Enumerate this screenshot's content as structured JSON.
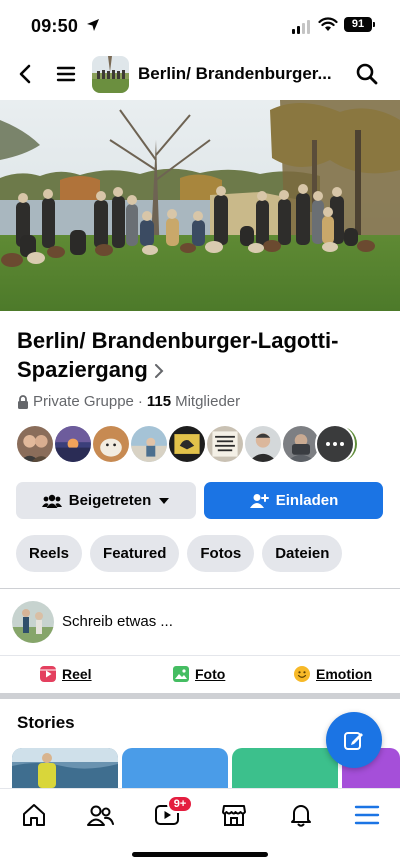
{
  "status_bar": {
    "time": "09:50",
    "battery": "91"
  },
  "header": {
    "title": "Berlin/ Brandenburger..."
  },
  "group": {
    "name": "Berlin/ Brandenburger-Lagotti-Spaziergang",
    "privacy": "Private Gruppe",
    "separator": "·",
    "member_count": "115",
    "member_label": "Mitglieder"
  },
  "buttons": {
    "joined": "Beigetreten",
    "invite": "Einladen"
  },
  "chips": [
    "Reels",
    "Featured",
    "Fotos",
    "Dateien"
  ],
  "composer": {
    "placeholder": "Schreib etwas ..."
  },
  "post_actions": {
    "reel": "Reel",
    "foto": "Foto",
    "emotion": "Emotion"
  },
  "stories": {
    "title": "Stories"
  },
  "tabbar": {
    "video_badge": "9+"
  },
  "colors": {
    "accent": "#1b74e4",
    "badge": "#e41e3f",
    "chip_bg": "#e4e6eb"
  }
}
